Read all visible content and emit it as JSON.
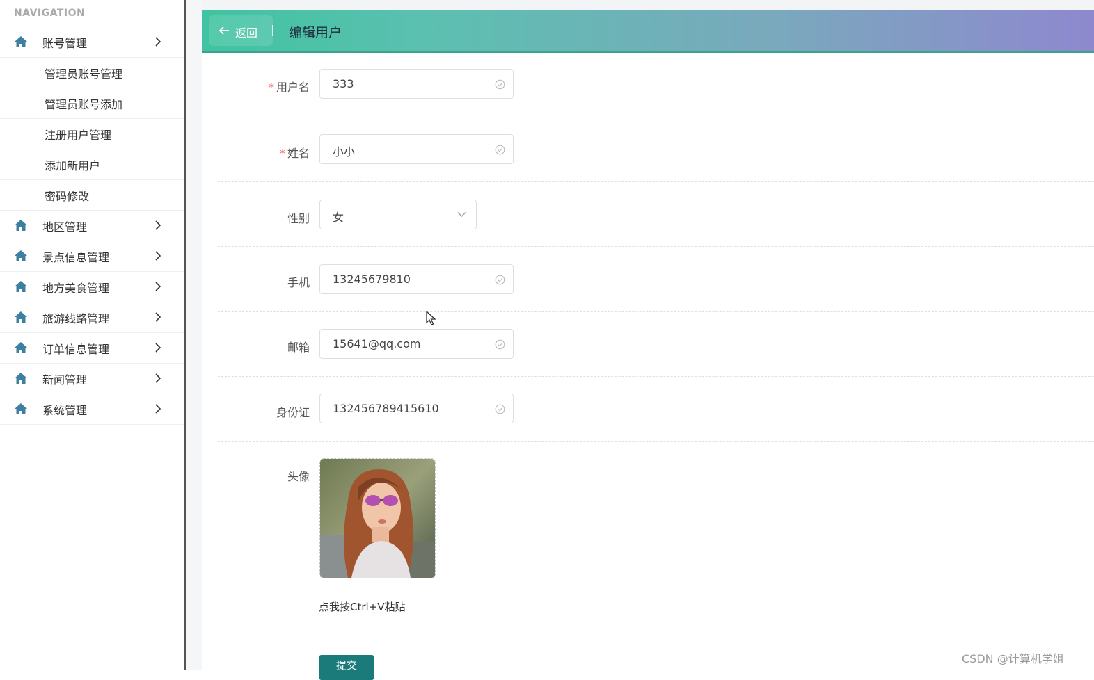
{
  "sidebar": {
    "heading": "NAVIGATION",
    "groups": [
      {
        "label": "账号管理",
        "icon": "home-icon"
      },
      {
        "label": "地区管理",
        "icon": "home-icon"
      },
      {
        "label": "景点信息管理",
        "icon": "home-icon"
      },
      {
        "label": "地方美食管理",
        "icon": "home-icon"
      },
      {
        "label": "旅游线路管理",
        "icon": "home-icon"
      },
      {
        "label": "订单信息管理",
        "icon": "home-icon"
      },
      {
        "label": "新闻管理",
        "icon": "home-icon"
      },
      {
        "label": "系统管理",
        "icon": "home-icon"
      }
    ],
    "sub_items": [
      "管理员账号管理",
      "管理员账号添加",
      "注册用户管理",
      "添加新用户",
      "密码修改"
    ]
  },
  "header": {
    "back_label": "返回",
    "title": "编辑用户"
  },
  "form": {
    "username": {
      "label": "用户名",
      "required": "*",
      "value": "333"
    },
    "name": {
      "label": "姓名",
      "required": "*",
      "value": "小小"
    },
    "gender": {
      "label": "性别",
      "value": "女"
    },
    "phone": {
      "label": "手机",
      "value": "13245679810"
    },
    "email": {
      "label": "邮箱",
      "value": "15641@qq.com"
    },
    "id_card": {
      "label": "身份证",
      "value": "132456789415610"
    },
    "avatar": {
      "label": "头像",
      "paste_tip": "点我按Ctrl+V粘贴"
    },
    "submit_label": "提交"
  },
  "watermark": "CSDN @计算机学姐",
  "colors": {
    "header_start": "#3fc3a0",
    "header_end": "#8e88cf",
    "icon": "#3d7fa0",
    "required": "#f56c6c",
    "submit": "#1b7a7a"
  }
}
